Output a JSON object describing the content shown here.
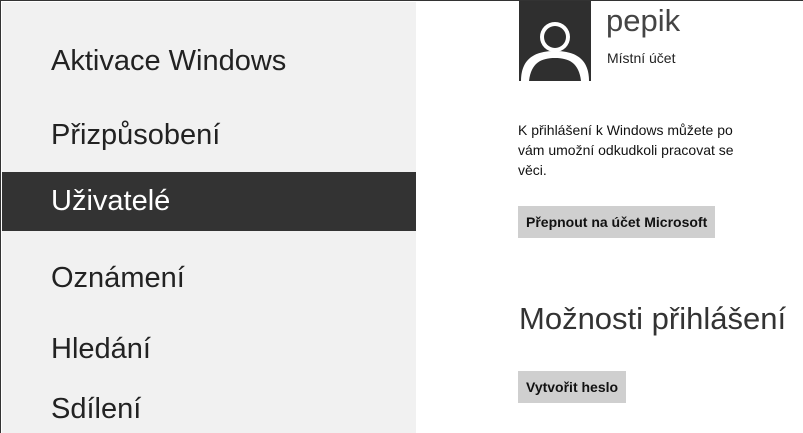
{
  "sidebar": {
    "items": [
      {
        "label": "Aktivace Windows",
        "active": false
      },
      {
        "label": "Přizpůsobení",
        "active": false
      },
      {
        "label": "Uživatelé",
        "active": true
      },
      {
        "label": "Oznámení",
        "active": false
      },
      {
        "label": "Hledání",
        "active": false
      },
      {
        "label": "Sdílení",
        "active": false
      }
    ]
  },
  "account": {
    "user_name": "pepik",
    "account_type": "Místní účet",
    "info_line_1": "K přihlášení k Windows můžete po",
    "info_line_2": "vám umožní odkudkoli pracovat se",
    "info_line_3": "věci.",
    "switch_button": "Přepnout na účet Microsoft"
  },
  "sign_in": {
    "title": "Možnosti přihlášení",
    "create_password_button": "Vytvořit heslo"
  },
  "colors": {
    "sidebar_bg": "#f1f1f1",
    "active_item_bg": "#333333",
    "button_bg": "#cfcfcf"
  }
}
